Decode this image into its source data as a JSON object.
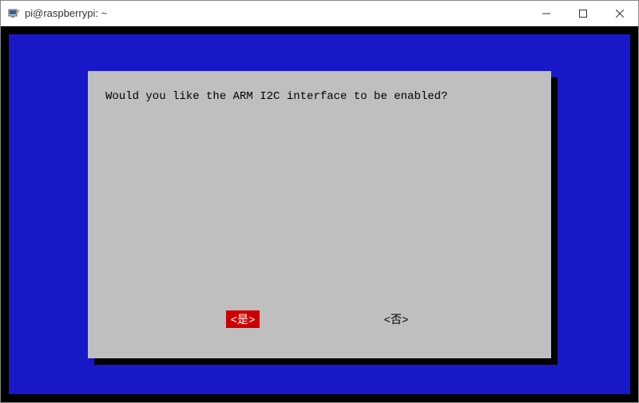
{
  "window": {
    "title": "pi@raspberrypi: ~"
  },
  "terminal": {
    "background_color": "#1818c8",
    "dialog_background": "#bfbfbf"
  },
  "dialog": {
    "message": "Would you like the ARM I2C interface to be enabled?",
    "yes_label": "<是>",
    "no_label": "<否>",
    "selected": "yes"
  }
}
